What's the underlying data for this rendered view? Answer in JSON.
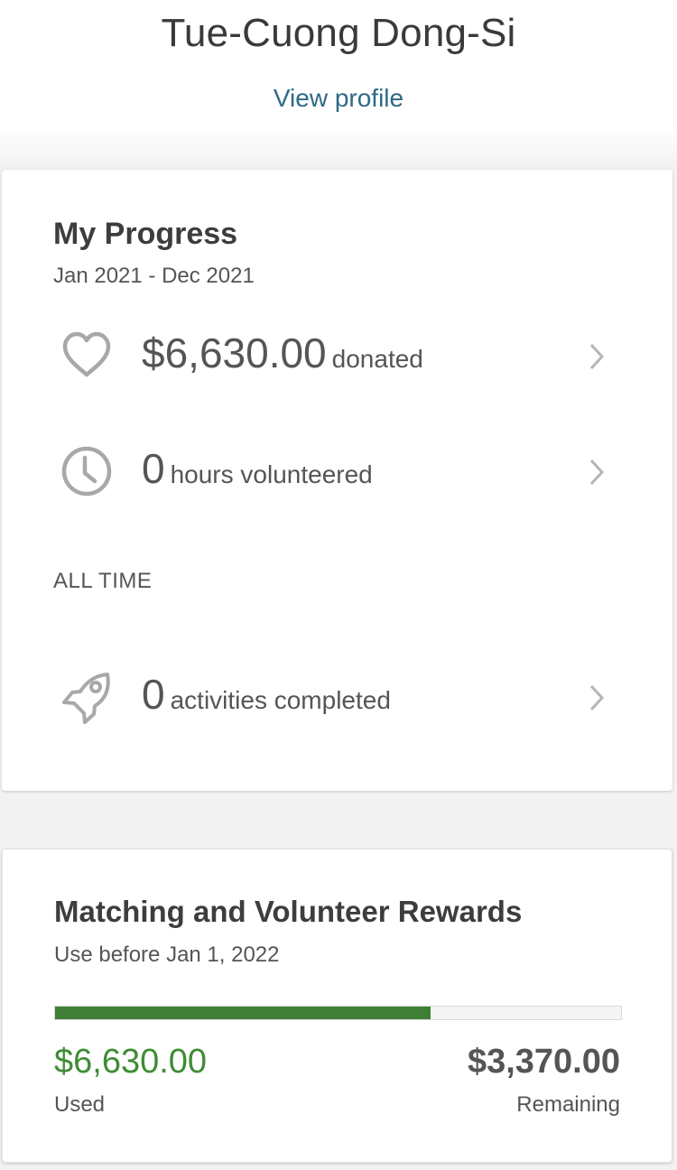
{
  "profile": {
    "name": "Tue-Cuong Dong-Si",
    "view_profile_label": "View profile"
  },
  "progress": {
    "title": "My Progress",
    "period": "Jan 2021 - Dec 2021",
    "donated": {
      "value": "$6,630.00",
      "unit": "donated",
      "icon": "heart-icon"
    },
    "hours": {
      "value": "0",
      "unit": "hours volunteered",
      "icon": "clock-icon"
    },
    "all_time_label": "ALL TIME",
    "activities": {
      "value": "0",
      "unit": "activities completed",
      "icon": "rocket-icon"
    }
  },
  "rewards": {
    "title": "Matching and Volunteer Rewards",
    "subtitle": "Use before Jan 1, 2022",
    "used_fraction": 0.663,
    "used_amount": "$6,630.00",
    "used_label": "Used",
    "remaining_amount": "$3,370.00",
    "remaining_label": "Remaining"
  },
  "colors": {
    "accent_green": "#3f7f35",
    "link_blue": "#2e6a86",
    "icon_gray": "#a8a8a8"
  }
}
